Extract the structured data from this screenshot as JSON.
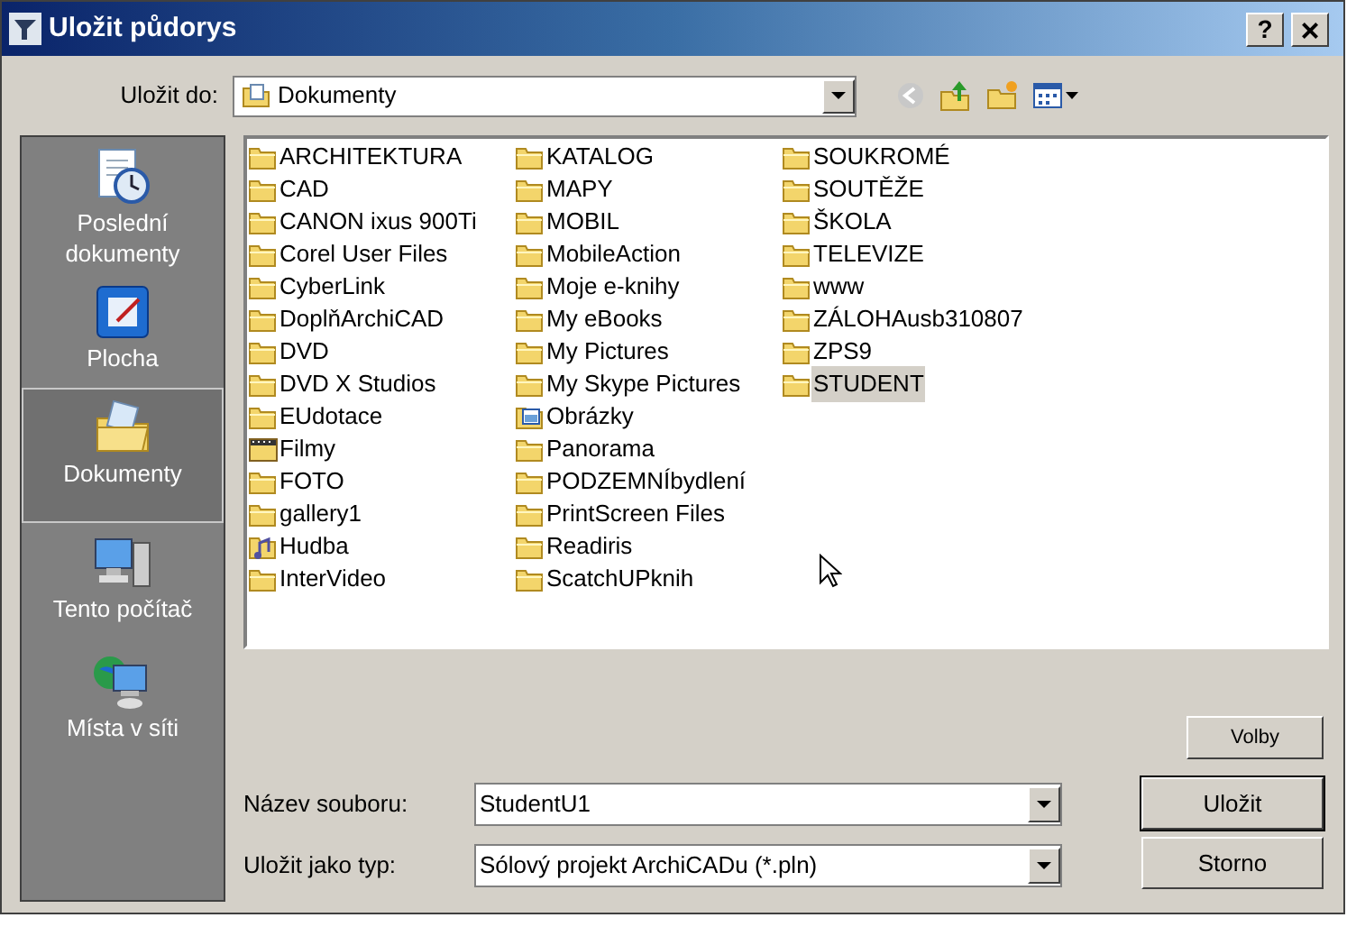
{
  "window": {
    "title": "Uložit půdorys",
    "help": "?",
    "close": "×"
  },
  "save_in": {
    "label": "Uložit do:",
    "value": "Dokumenty"
  },
  "places": [
    {
      "label": "Poslední dokumenty",
      "kind": "recent",
      "selected": false
    },
    {
      "label": "Plocha",
      "kind": "desktop",
      "selected": false
    },
    {
      "label": "Dokumenty",
      "kind": "documents",
      "selected": true
    },
    {
      "label": "Tento počítač",
      "kind": "computer",
      "selected": false
    },
    {
      "label": "Místa v síti",
      "kind": "network",
      "selected": false
    }
  ],
  "files": [
    {
      "name": "ARCHITEKTURA",
      "kind": "folder",
      "selected": false
    },
    {
      "name": "CAD",
      "kind": "folder",
      "selected": false
    },
    {
      "name": "CANON ixus 900Ti",
      "kind": "folder",
      "selected": false
    },
    {
      "name": "Corel User Files",
      "kind": "folder",
      "selected": false
    },
    {
      "name": "CyberLink",
      "kind": "folder",
      "selected": false
    },
    {
      "name": "DoplňArchiCAD",
      "kind": "folder",
      "selected": false
    },
    {
      "name": "DVD",
      "kind": "folder",
      "selected": false
    },
    {
      "name": "DVD X Studios",
      "kind": "folder",
      "selected": false
    },
    {
      "name": "EUdotace",
      "kind": "folder",
      "selected": false
    },
    {
      "name": "Filmy",
      "kind": "video",
      "selected": false
    },
    {
      "name": "FOTO",
      "kind": "folder",
      "selected": false
    },
    {
      "name": "gallery1",
      "kind": "folder",
      "selected": false
    },
    {
      "name": "Hudba",
      "kind": "music",
      "selected": false
    },
    {
      "name": "InterVideo",
      "kind": "folder",
      "selected": false
    },
    {
      "name": "KATALOG",
      "kind": "folder",
      "selected": false
    },
    {
      "name": "MAPY",
      "kind": "folder",
      "selected": false
    },
    {
      "name": "MOBIL",
      "kind": "folder",
      "selected": false
    },
    {
      "name": "MobileAction",
      "kind": "folder",
      "selected": false
    },
    {
      "name": "Moje e-knihy",
      "kind": "folder",
      "selected": false
    },
    {
      "name": "My eBooks",
      "kind": "folder",
      "selected": false
    },
    {
      "name": "My Pictures",
      "kind": "folder",
      "selected": false
    },
    {
      "name": "My Skype Pictures",
      "kind": "folder",
      "selected": false
    },
    {
      "name": "Obrázky",
      "kind": "pictures",
      "selected": false
    },
    {
      "name": "Panorama",
      "kind": "folder",
      "selected": false
    },
    {
      "name": "PODZEMNÍbydlení",
      "kind": "folder",
      "selected": false
    },
    {
      "name": "PrintScreen Files",
      "kind": "folder",
      "selected": false
    },
    {
      "name": "Readiris",
      "kind": "folder",
      "selected": false
    },
    {
      "name": "ScatchUPknih",
      "kind": "folder",
      "selected": false
    },
    {
      "name": "SOUKROMÉ",
      "kind": "folder",
      "selected": false
    },
    {
      "name": "SOUTĚŽE",
      "kind": "folder",
      "selected": false
    },
    {
      "name": "ŠKOLA",
      "kind": "folder",
      "selected": false
    },
    {
      "name": "TELEVIZE",
      "kind": "folder",
      "selected": false
    },
    {
      "name": "www",
      "kind": "folder",
      "selected": false
    },
    {
      "name": "ZÁLOHAusb310807",
      "kind": "folder",
      "selected": false
    },
    {
      "name": "ZPS9",
      "kind": "folder",
      "selected": false
    },
    {
      "name": "STUDENT",
      "kind": "folder",
      "selected": true
    }
  ],
  "options_button": "Volby",
  "file_name": {
    "label": "Název souboru:",
    "value": "StudentU1"
  },
  "file_type": {
    "label": "Uložit jako typ:",
    "value": "Sólový projekt ArchiCADu (*.pln)"
  },
  "buttons": [
    "Uložit",
    "Storno"
  ]
}
